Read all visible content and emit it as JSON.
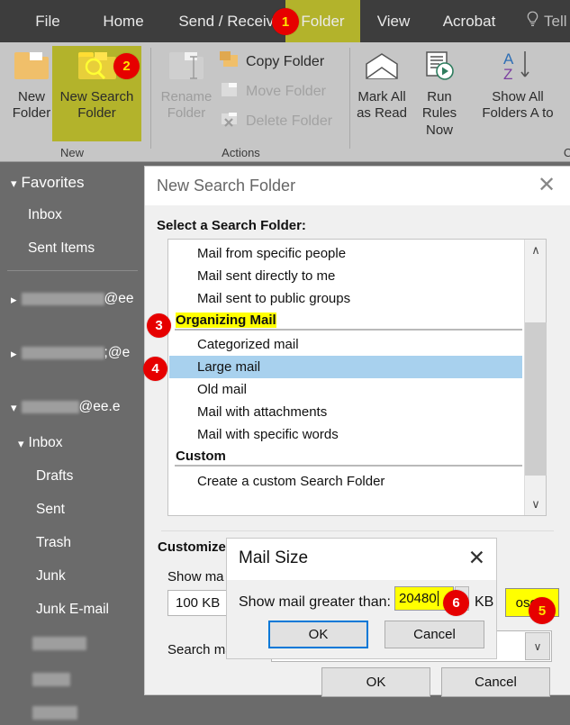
{
  "ribbon": {
    "tabs": [
      {
        "label": "File",
        "highlight": false
      },
      {
        "label": "Home",
        "highlight": false
      },
      {
        "label": "Send / Receive",
        "highlight": false
      },
      {
        "label": "Folder",
        "highlight": true
      },
      {
        "label": "View",
        "highlight": false
      },
      {
        "label": "Acrobat",
        "highlight": false
      }
    ],
    "tell_me": "Tell m",
    "groups": [
      {
        "label": "New"
      },
      {
        "label": "Actions"
      },
      {
        "label": "Clear"
      }
    ],
    "new_folder": "New\nFolder",
    "new_folder_l1": "New",
    "new_folder_l2": "Folder",
    "new_search_folder_l1": "New Search",
    "new_search_folder_l2": "Folder",
    "rename_folder_l1": "Rename",
    "rename_folder_l2": "Folder",
    "copy_folder": "Copy Folder",
    "move_folder": "Move Folder",
    "delete_folder": "Delete Folder",
    "mark_all_l1": "Mark All",
    "mark_all_l2": "as Read",
    "run_rules_l1": "Run Rules",
    "run_rules_l2": "Now",
    "show_all_l1": "Show All",
    "show_all_l2": "Folders A to"
  },
  "sidebar": {
    "favorites": "Favorites",
    "inbox_fav": "Inbox",
    "sent_items_fav": "Sent Items",
    "account1_suffix": "@ee",
    "account2_suffix": "@e",
    "account2_prechar": ";",
    "account3_suffix": "@ee.e",
    "inbox": "Inbox",
    "drafts": "Drafts",
    "sent": "Sent",
    "trash": "Trash",
    "junk": "Junk",
    "junk_email": "Junk E-mail"
  },
  "dialog": {
    "title": "New Search Folder",
    "close": "✕",
    "subtitle": "Select a Search Folder:",
    "list": [
      {
        "text": "Mail from specific people",
        "type": "item"
      },
      {
        "text": "Mail sent directly to me",
        "type": "item"
      },
      {
        "text": "Mail sent to public groups",
        "type": "item"
      },
      {
        "text": "Organizing Mail",
        "type": "header",
        "highlight": true
      },
      {
        "text": "Categorized mail",
        "type": "item"
      },
      {
        "text": "Large mail",
        "type": "item",
        "selected": true
      },
      {
        "text": "Old mail",
        "type": "item"
      },
      {
        "text": "Mail with attachments",
        "type": "item"
      },
      {
        "text": "Mail with specific words",
        "type": "item"
      },
      {
        "text": "Custom",
        "type": "header"
      },
      {
        "text": "Create a custom Search Folder",
        "type": "item"
      }
    ],
    "scroll_up": "∧",
    "scroll_down": "∨",
    "customize_label": "Customize",
    "show_mail_label": "Show ma",
    "size_value": "100 KB",
    "choose_button": "ose...",
    "search_mail_label": "Search ma",
    "combo_arrow": "∨",
    "ok": "OK",
    "cancel": "Cancel"
  },
  "mail_size": {
    "title": "Mail Size",
    "close": "✕",
    "prompt": "Show mail greater than:",
    "value": "20480",
    "unit": "KB",
    "ok": "OK",
    "cancel": "Cancel"
  },
  "badges": [
    {
      "n": "1"
    },
    {
      "n": "2"
    },
    {
      "n": "3"
    },
    {
      "n": "4"
    },
    {
      "n": "5"
    },
    {
      "n": "6"
    }
  ],
  "colors": {
    "highlight_yellow": "#ffff00",
    "ribbon_highlight": "#b3b32b",
    "badge_red": "#e60000",
    "badge_text": "#ffe400",
    "selection_blue": "#a8d1ee",
    "primary_border": "#0078d7"
  }
}
